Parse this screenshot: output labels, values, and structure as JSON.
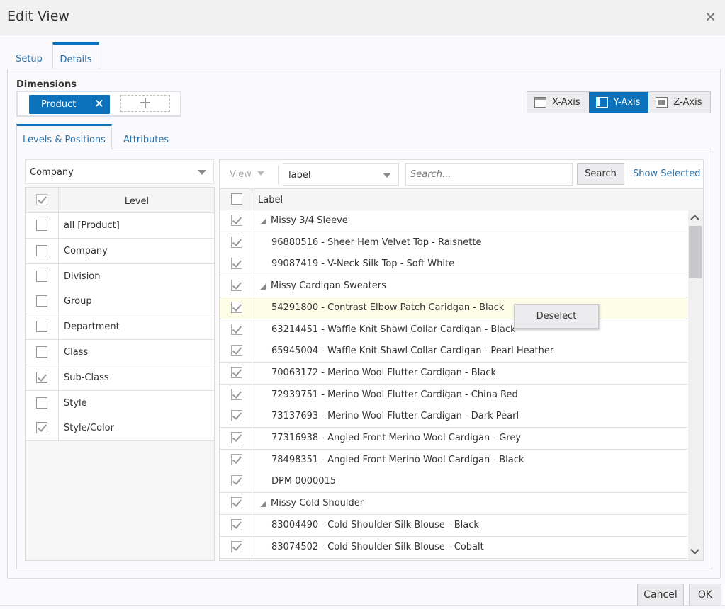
{
  "dialog": {
    "title": "Edit View",
    "close_icon": "close-icon"
  },
  "main_tabs": [
    {
      "label": "Setup",
      "active": false
    },
    {
      "label": "Details",
      "active": true
    }
  ],
  "dimensions": {
    "label": "Dimensions",
    "chips": [
      {
        "label": "Product",
        "remove_icon": "close-icon"
      }
    ],
    "add_icon": "plus-icon"
  },
  "axis_buttons": [
    {
      "label": "X-Axis",
      "icon": "x-axis-icon",
      "active": false
    },
    {
      "label": "Y-Axis",
      "icon": "y-axis-icon",
      "active": true
    },
    {
      "label": "Z-Axis",
      "icon": "z-axis-icon",
      "active": false
    }
  ],
  "sub_tabs": [
    {
      "label": "Levels & Positions",
      "active": true
    },
    {
      "label": "Attributes",
      "active": false
    }
  ],
  "hierarchy_select": {
    "value": "Company"
  },
  "levels_table": {
    "header": "Level",
    "rows": [
      {
        "label": "all [Product]",
        "checked": false
      },
      {
        "label": "Company",
        "checked": false
      },
      {
        "label": "Division",
        "checked": false
      },
      {
        "label": "Group",
        "checked": false
      },
      {
        "label": "Department",
        "checked": false
      },
      {
        "label": "Class",
        "checked": false
      },
      {
        "label": "Sub-Class",
        "checked": true
      },
      {
        "label": "Style",
        "checked": false
      },
      {
        "label": "Style/Color",
        "checked": true
      }
    ]
  },
  "toolbar": {
    "view_label": "View",
    "attribute_select": "label",
    "search_placeholder": "Search...",
    "search_button": "Search",
    "show_selected_link": "Show Selected"
  },
  "positions_grid": {
    "header": "Label",
    "rows": [
      {
        "label": "Missy 3/4 Sleeve",
        "group": true,
        "checked": true
      },
      {
        "label": "96880516 - Sheer Hem Velvet Top - Raisnette",
        "group": false,
        "checked": true
      },
      {
        "label": "99087419 - V-Neck Silk Top - Soft White",
        "group": false,
        "checked": true
      },
      {
        "label": "Missy Cardigan Sweaters",
        "group": true,
        "checked": true
      },
      {
        "label": "54291800 - Contrast Elbow Patch Caridgan - Black",
        "group": false,
        "checked": true,
        "highlighted": true
      },
      {
        "label": "63214451 - Waffle Knit Shawl Collar Cardigan - Black",
        "group": false,
        "checked": true
      },
      {
        "label": "65945004 - Waffle Knit Shawl Collar Cardigan - Pearl Heather",
        "group": false,
        "checked": true
      },
      {
        "label": "70063172 - Merino Wool Flutter Cardigan - Black",
        "group": false,
        "checked": true
      },
      {
        "label": "72939751 - Merino Wool Flutter Cardigan - China Red",
        "group": false,
        "checked": true
      },
      {
        "label": "73137693 - Merino Wool Flutter Cardigan - Dark Pearl",
        "group": false,
        "checked": true
      },
      {
        "label": "77316938 - Angled Front Merino Wool Cardigan - Grey",
        "group": false,
        "checked": true
      },
      {
        "label": "78498351 - Angled Front Merino Wool Cardigan - Black",
        "group": false,
        "checked": true
      },
      {
        "label": "DPM 0000015",
        "group": false,
        "checked": true
      },
      {
        "label": "Missy Cold Shoulder",
        "group": true,
        "checked": true
      },
      {
        "label": "83004490 - Cold Shoulder Silk Blouse - Black",
        "group": false,
        "checked": true
      },
      {
        "label": "83074502 - Cold Shoulder Silk Blouse - Cobalt",
        "group": false,
        "checked": true
      }
    ]
  },
  "context_menu": {
    "items": [
      "Deselect"
    ]
  },
  "footer": {
    "cancel_label": "Cancel",
    "ok_label": "OK"
  },
  "colors": {
    "accent": "#0d72bc",
    "link": "#2a6fa8",
    "highlight_row": "#fdfde8"
  }
}
